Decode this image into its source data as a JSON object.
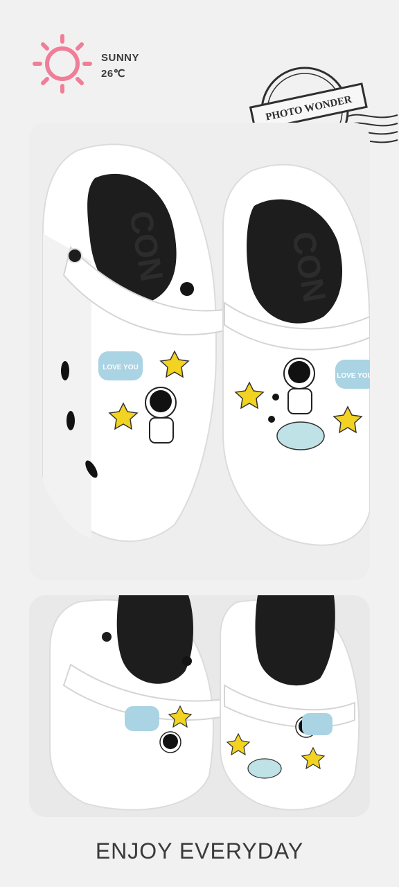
{
  "weather": {
    "icon": "sun-icon",
    "condition": "SUNNY",
    "temperature": "26℃",
    "icon_color": "#f07e98"
  },
  "stamp": {
    "text": "PHOTO WONDER",
    "icon": "postmark-stamp-icon"
  },
  "photos": [
    {
      "subject": "pair of white clog sandals with black insoles and charms",
      "insole_text": "CON"
    },
    {
      "subject": "pair of white clog sandals with black insoles and charms",
      "insole_text": "CON"
    }
  ],
  "charms": {
    "love_badge": "LOVE YOU",
    "figure": "astronaut"
  },
  "footer": {
    "caption": "ENJOY EVERYDAY"
  }
}
